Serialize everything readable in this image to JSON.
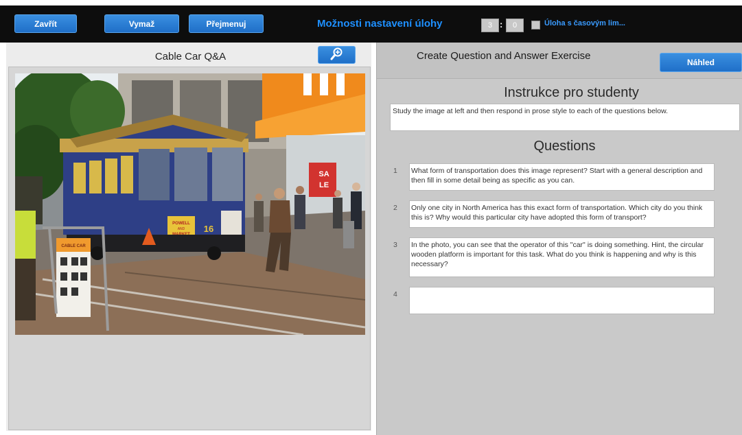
{
  "toolbar": {
    "close_label": "Zavřít",
    "clear_label": "Vymaž",
    "rename_label": "Přejmenuj",
    "title": "Možnosti nastavení úlohy",
    "time_minutes": "3",
    "time_colon": ":",
    "time_seconds": "0",
    "time_limit_label": "Úloha s časovým lim..."
  },
  "left_panel": {
    "title": "Cable Car Q&A",
    "zoom_icon": "zoom-in-icon"
  },
  "right_panel": {
    "title": "Create Question and Answer Exercise",
    "preview_label": "Náhled",
    "instructions_heading": "Instrukce pro studenty",
    "instructions_text": "Study the image at left and then respond in prose style to each of the questions below.",
    "questions_heading": "Questions",
    "questions": [
      {
        "number": "1",
        "text": "What form of transportation does this image represent?  Start with a general description and then fill in some detail being as specific as you can."
      },
      {
        "number": "2",
        "text": "Only one city in North America has this exact form of transportation.  Which city do you think this is?   Why would this particular city have adopted this form of transport?"
      },
      {
        "number": "3",
        "text": "In the photo, you can see that the operator of this \"car\" is doing something.  Hint, the circular wooden platform is important for this task.   What do you think is happening and why is this necessary?"
      },
      {
        "number": "4",
        "text": ""
      }
    ]
  },
  "photo": {
    "sign_text_1": "POWELL",
    "sign_text_2": "AND",
    "sign_text_3": "MARKET",
    "car_number": "16",
    "sale_sign_1": "SA",
    "sale_sign_2": "LE",
    "board_sign": "CABLE CAR"
  }
}
